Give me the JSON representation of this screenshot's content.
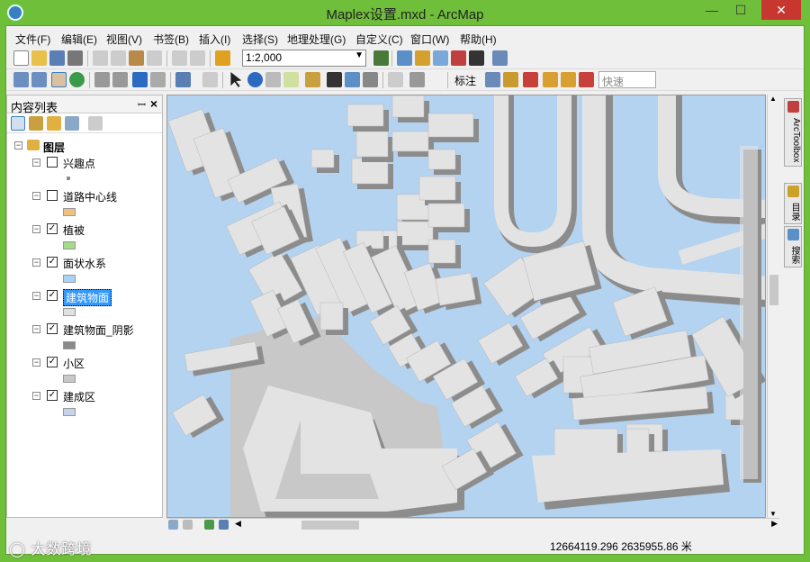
{
  "window": {
    "title": "Maplex设置.mxd - ArcMap",
    "minimize": "—",
    "maximize": "☐",
    "close": "✕"
  },
  "menu": [
    "文件(F)",
    "编辑(E)",
    "视图(V)",
    "书签(B)",
    "插入(I)",
    "选择(S)",
    "地理处理(G)",
    "自定义(C)",
    "窗口(W)",
    "帮助(H)"
  ],
  "toolbar": {
    "scale_value": "1:2,000",
    "labeling_label": "标注",
    "labeling_combo": "快速"
  },
  "toc": {
    "title": "内容列表",
    "pin": "ꟷ",
    "close": "✕",
    "root": "图层",
    "layers": [
      {
        "name": "兴趣点",
        "checked": false,
        "swatch": "#777777"
      },
      {
        "name": "道路中心线",
        "checked": false,
        "swatch": "#f0c080"
      },
      {
        "name": "植被",
        "checked": true,
        "swatch": "#a6d98a"
      },
      {
        "name": "面状水系",
        "checked": true,
        "swatch": "#a9d3f5"
      },
      {
        "name": "建筑物面",
        "checked": true,
        "swatch": "#e0e0e0",
        "selected": true
      },
      {
        "name": "建筑物面_阴影",
        "checked": true,
        "swatch": "#8a8a8a"
      },
      {
        "name": "小区",
        "checked": true,
        "swatch": "#c8c8c8"
      },
      {
        "name": "建成区",
        "checked": true,
        "swatch": "#c5d3ea"
      }
    ],
    "check_mark": "✓"
  },
  "dock": {
    "arctoolbox": "ArcToolbox",
    "catalog": "目录",
    "search": "搜索"
  },
  "status": {
    "coordinates": "12664119.296  2635955.86 米"
  },
  "watermark": "大数跨境",
  "colors": {
    "water": "#b4d3f0",
    "building": "#e3e3e3",
    "shadow": "#8c8c8c",
    "residential": "#c8c8c8",
    "window_frame": "#6fbf3a"
  }
}
